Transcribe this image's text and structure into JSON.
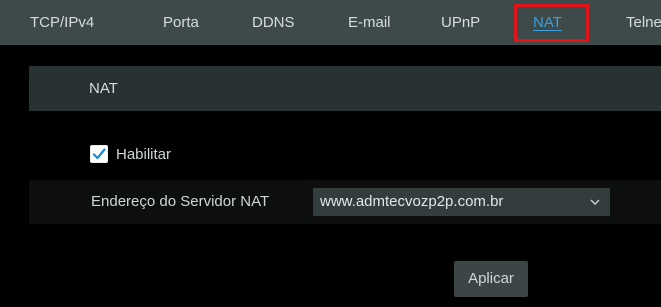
{
  "tabs": [
    {
      "label": "TCP/IPv4"
    },
    {
      "label": "Porta"
    },
    {
      "label": "DDNS"
    },
    {
      "label": "E-mail"
    },
    {
      "label": "UPnP"
    },
    {
      "label": "NAT",
      "active": true
    },
    {
      "label": "Telnet"
    }
  ],
  "section": {
    "title": "NAT"
  },
  "enable": {
    "label": "Habilitar",
    "checked": true
  },
  "server": {
    "label": "Endereço do Servidor NAT",
    "selected": "www.admtecvozp2p.com.br",
    "icon": "chevron-down-icon"
  },
  "apply_label": "Aplicar",
  "colors": {
    "accent": "#3aa0e0",
    "highlight": "#e0151b",
    "tabbar_bg": "#3e4a4a",
    "header_bg": "#283232"
  }
}
